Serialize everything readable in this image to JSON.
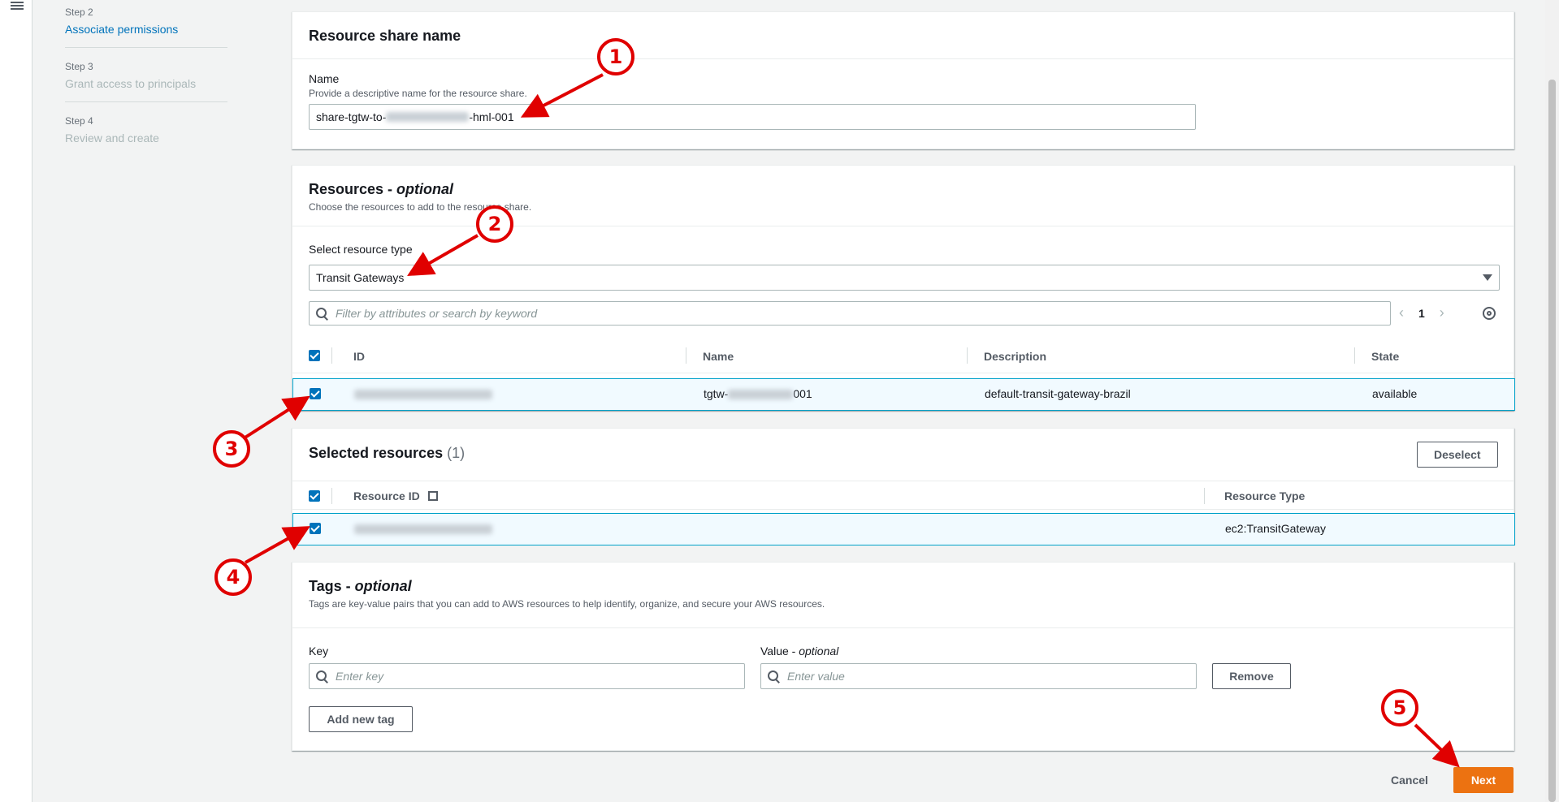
{
  "wizard": {
    "steps": [
      {
        "num": "Step 2",
        "title": "Associate permissions"
      },
      {
        "num": "Step 3",
        "title": "Grant access to principals"
      },
      {
        "num": "Step 4",
        "title": "Review and create"
      }
    ]
  },
  "share_name": {
    "title": "Resource share name",
    "field_label": "Name",
    "field_desc": "Provide a descriptive name for the resource share.",
    "value_prefix": "share-tgtw-to-",
    "value_suffix": "-hml-001"
  },
  "resources": {
    "title": "Resources - ",
    "title_optional": "optional",
    "desc": "Choose the resources to add to the resource share.",
    "type_label": "Select resource type",
    "type_value": "Transit Gateways",
    "search_placeholder": "Filter by attributes or search by keyword",
    "page": "1",
    "columns": [
      "ID",
      "Name",
      "Description",
      "State"
    ],
    "row": {
      "name_prefix": "tgtw-",
      "name_suffix": "001",
      "description": "default-transit-gateway-brazil",
      "state": "available"
    }
  },
  "selected": {
    "title": "Selected resources",
    "count": "(1)",
    "deselect_label": "Deselect",
    "columns": [
      "Resource ID",
      "Resource Type"
    ],
    "row": {
      "type": "ec2:TransitGateway"
    }
  },
  "tags": {
    "title": "Tags - ",
    "title_optional": "optional",
    "desc": "Tags are key-value pairs that you can add to AWS resources to help identify, organize, and secure your AWS resources.",
    "key_label": "Key",
    "value_label": "Value - ",
    "value_label_optional": "optional",
    "key_placeholder": "Enter key",
    "value_placeholder": "Enter value",
    "remove_label": "Remove",
    "add_label": "Add new tag"
  },
  "footer": {
    "cancel_label": "Cancel",
    "next_label": "Next"
  },
  "annotations": [
    "1",
    "2",
    "3",
    "4",
    "5"
  ],
  "colors": {
    "accent": "#0073bb",
    "primary_button": "#ec7211",
    "annotation": "#e00000"
  }
}
